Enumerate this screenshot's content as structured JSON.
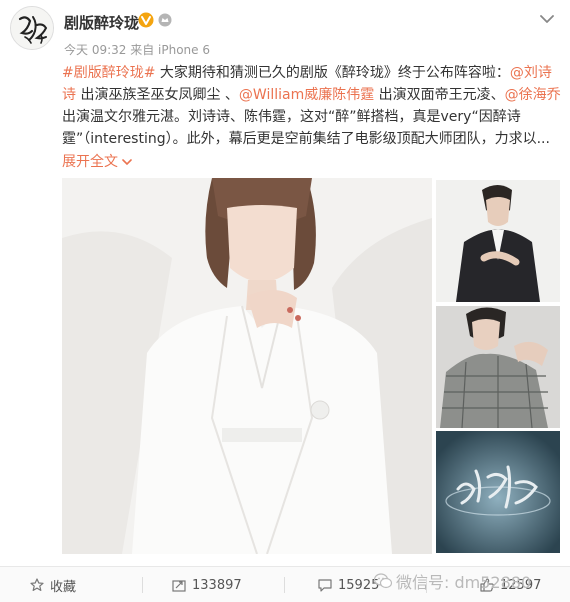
{
  "account": {
    "username": "剧版醉玲珑",
    "avatar_logo_text": "醉玲珑",
    "meta": "今天 09:32 来自 iPhone 6"
  },
  "post": {
    "segments": [
      {
        "text": "#剧版醉玲珑#",
        "highlight": true
      },
      {
        "text": " 大家期待和猜测已久的剧版《醉玲珑》终于公布阵容啦：",
        "highlight": false
      },
      {
        "text": "@刘诗诗",
        "highlight": true
      },
      {
        "text": " 出演巫族圣巫女凤卿尘 、",
        "highlight": false
      },
      {
        "text": "@William威廉陈伟霆",
        "highlight": true
      },
      {
        "text": " 出演双面帝王元凌、",
        "highlight": false
      },
      {
        "text": "@徐海乔",
        "highlight": true
      },
      {
        "text": " 出演温文尔雅元湛。刘诗诗、陈伟霆，这对“醉”鲜搭档，真是very“因醉诗霆”（interesting）。此外，幕后更是空前集结了电影级顶配大师团队，力求以...",
        "highlight": false
      }
    ],
    "expand_label": "展开全文",
    "poster_logo_text": "醉玲珑"
  },
  "actions": {
    "favorite_label": "收藏",
    "repost_count": "133897",
    "comment_count": "15925",
    "like_count": "12597"
  },
  "watermark": {
    "text": "微信号: dm52880"
  },
  "colors": {
    "accent": "#eb7350",
    "verified": "#f4a40f"
  }
}
